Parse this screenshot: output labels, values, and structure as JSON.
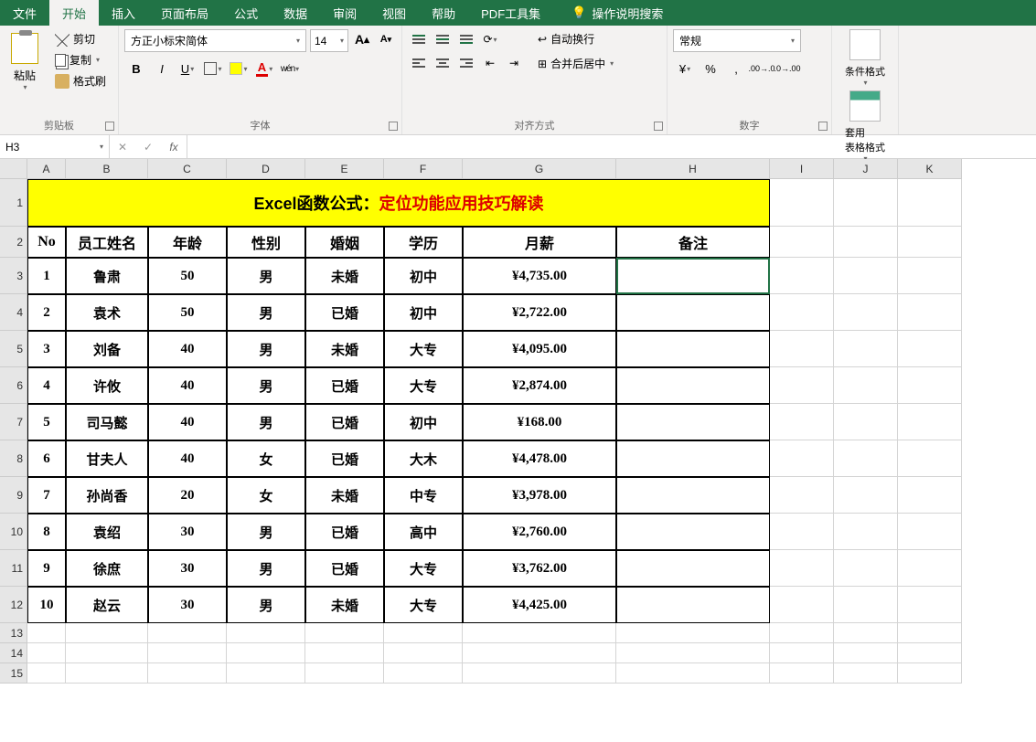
{
  "menu": {
    "file": "文件",
    "home": "开始",
    "insert": "插入",
    "page_layout": "页面布局",
    "formulas": "公式",
    "data": "数据",
    "review": "审阅",
    "view": "视图",
    "help": "帮助",
    "pdf": "PDF工具集",
    "tell_me": "操作说明搜索"
  },
  "ribbon": {
    "clipboard": {
      "label": "剪贴板",
      "paste": "粘贴",
      "cut": "剪切",
      "copy": "复制",
      "format_painter": "格式刷"
    },
    "font": {
      "label": "字体",
      "name": "方正小标宋简体",
      "size": "14",
      "inc": "A",
      "dec": "A",
      "bold": "B",
      "italic": "I",
      "underline": "U",
      "wen": "wén"
    },
    "alignment": {
      "label": "对齐方式",
      "wrap": "自动换行",
      "merge": "合并后居中"
    },
    "number": {
      "label": "数字",
      "format": "常规"
    },
    "styles": {
      "cond": "条件格式",
      "table": "套用\n表格格式"
    }
  },
  "formula_bar": {
    "name_box": "H3",
    "fx": "fx",
    "value": ""
  },
  "columns": [
    "A",
    "B",
    "C",
    "D",
    "E",
    "F",
    "G",
    "H",
    "I",
    "J",
    "K"
  ],
  "row_nums": [
    "1",
    "2",
    "3",
    "4",
    "5",
    "6",
    "7",
    "8",
    "9",
    "10",
    "11",
    "12",
    "13",
    "14",
    "15"
  ],
  "title": {
    "t1": "Excel函数公式：",
    "t2": "定位功能应用技巧解读"
  },
  "headers": [
    "No",
    "员工姓名",
    "年龄",
    "性别",
    "婚姻",
    "学历",
    "月薪",
    "备注"
  ],
  "rows": [
    {
      "no": "1",
      "name": "鲁肃",
      "age": "50",
      "sex": "男",
      "mar": "未婚",
      "edu": "初中",
      "sal": "¥4,735.00",
      "note": ""
    },
    {
      "no": "2",
      "name": "袁术",
      "age": "50",
      "sex": "男",
      "mar": "已婚",
      "edu": "初中",
      "sal": "¥2,722.00",
      "note": ""
    },
    {
      "no": "3",
      "name": "刘备",
      "age": "40",
      "sex": "男",
      "mar": "未婚",
      "edu": "大专",
      "sal": "¥4,095.00",
      "note": ""
    },
    {
      "no": "4",
      "name": "许攸",
      "age": "40",
      "sex": "男",
      "mar": "已婚",
      "edu": "大专",
      "sal": "¥2,874.00",
      "note": ""
    },
    {
      "no": "5",
      "name": "司马懿",
      "age": "40",
      "sex": "男",
      "mar": "已婚",
      "edu": "初中",
      "sal": "¥168.00",
      "note": ""
    },
    {
      "no": "6",
      "name": "甘夫人",
      "age": "40",
      "sex": "女",
      "mar": "已婚",
      "edu": "大木",
      "sal": "¥4,478.00",
      "note": ""
    },
    {
      "no": "7",
      "name": "孙尚香",
      "age": "20",
      "sex": "女",
      "mar": "未婚",
      "edu": "中专",
      "sal": "¥3,978.00",
      "note": ""
    },
    {
      "no": "8",
      "name": "袁绍",
      "age": "30",
      "sex": "男",
      "mar": "已婚",
      "edu": "高中",
      "sal": "¥2,760.00",
      "note": ""
    },
    {
      "no": "9",
      "name": "徐庶",
      "age": "30",
      "sex": "男",
      "mar": "已婚",
      "edu": "大专",
      "sal": "¥3,762.00",
      "note": ""
    },
    {
      "no": "10",
      "name": "赵云",
      "age": "30",
      "sex": "男",
      "mar": "未婚",
      "edu": "大专",
      "sal": "¥4,425.00",
      "note": ""
    }
  ],
  "selected_cell": "H3"
}
